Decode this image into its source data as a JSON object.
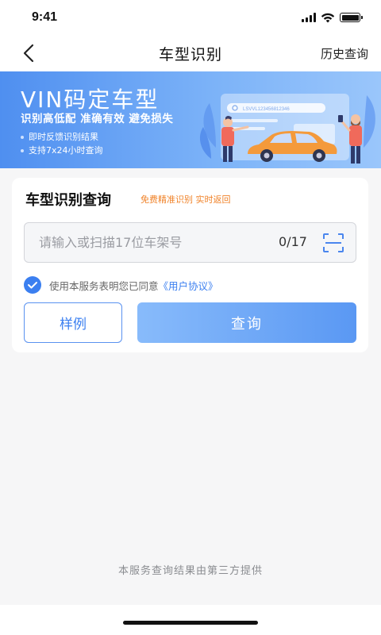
{
  "status_bar": {
    "time": "9:41"
  },
  "nav": {
    "title": "车型识别",
    "history_label": "历史查询"
  },
  "banner": {
    "title": "VIN码定车型",
    "subtitle": "识别高低配 准确有效 避免损失",
    "bullets": [
      "即时反馈识别结果",
      "支持7x24小时查询"
    ],
    "illustration_search_text": "LSVVL123456812346"
  },
  "card": {
    "title": "车型识别查询",
    "tag": "免费精准识别 实时返回",
    "vin_input": {
      "value": "",
      "placeholder": "请输入或扫描17位车架号",
      "counter": "0/17"
    },
    "agreement": {
      "text": "使用本服务表明您已同意",
      "link": "《用户协议》",
      "checked": true
    },
    "sample_button": "样例",
    "query_button": "查询"
  },
  "footer": {
    "note": "本服务查询结果由第三方提供"
  },
  "colors": {
    "accent": "#3b7ff0",
    "tag_orange": "#f0832a",
    "banner_start": "#4f8ff0",
    "banner_end": "#9ac6fb"
  }
}
